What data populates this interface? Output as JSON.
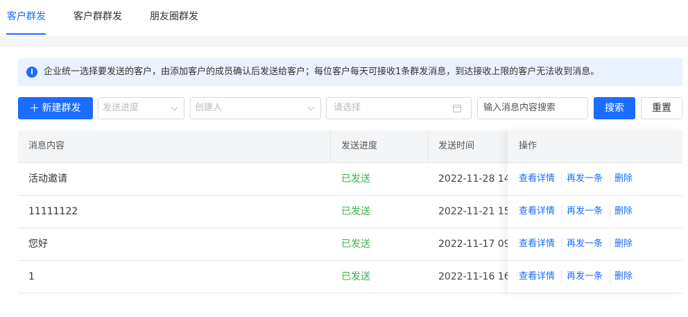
{
  "tabs": [
    {
      "label": "客户群发",
      "active": true
    },
    {
      "label": "客户群群发",
      "active": false
    },
    {
      "label": "朋友圈群发",
      "active": false
    }
  ],
  "notice": {
    "icon": "info-icon",
    "text": "企业统一选择要发送的客户，由添加客户的成员确认后发送给客户；每位客户每天可接收1条群发消息，到达接收上限的客户无法收到消息。"
  },
  "toolbar": {
    "new_label": "新建群发",
    "progress_placeholder": "发送进度",
    "creator_placeholder": "创建人",
    "date_placeholder": "请选择",
    "search_placeholder": "输入消息内容搜索",
    "search_label": "搜索",
    "reset_label": "重置"
  },
  "table": {
    "columns": [
      "消息内容",
      "发送进度",
      "发送时间",
      "操作"
    ],
    "rows": [
      {
        "content": "活动邀请",
        "status": "已发送",
        "time": "2022-11-28 14:"
      },
      {
        "content": "11111122",
        "status": "已发送",
        "time": "2022-11-21 15:"
      },
      {
        "content": "您好",
        "status": "已发送",
        "time": "2022-11-17 09:"
      },
      {
        "content": "1",
        "status": "已发送",
        "time": "2022-11-16 16:"
      }
    ],
    "actions": [
      "查看详情",
      "再发一条",
      "删除"
    ]
  },
  "colors": {
    "accent": "#1b6cff",
    "success": "#3bb347"
  }
}
